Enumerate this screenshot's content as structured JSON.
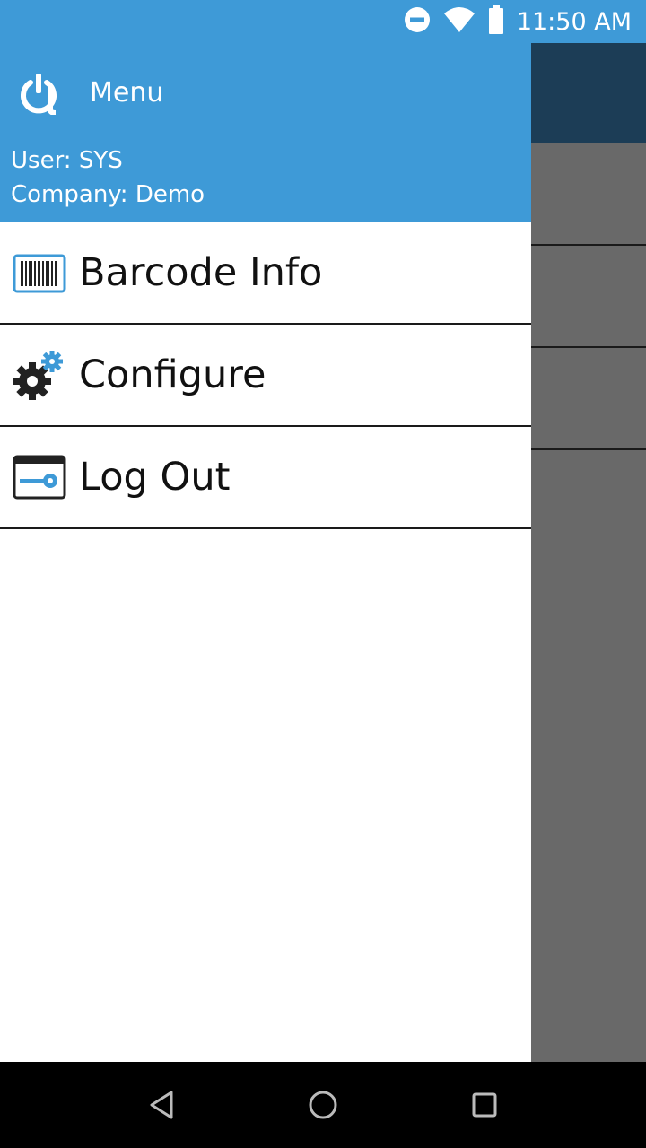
{
  "status_bar": {
    "time": "11:50 AM",
    "icons": [
      "do-not-disturb-icon",
      "wifi-icon",
      "battery-icon"
    ]
  },
  "drawer": {
    "header": {
      "title": "Menu",
      "user": "User: SYS",
      "company": "Company: Demo",
      "logo_icon": "power-logo-icon"
    },
    "items": [
      {
        "label": "Barcode Info",
        "icon": "barcode-icon"
      },
      {
        "label": "Configure",
        "icon": "gears-icon"
      },
      {
        "label": "Log Out",
        "icon": "key-card-icon"
      }
    ]
  },
  "nav_bar": {
    "buttons": [
      "back-icon",
      "home-icon",
      "recents-icon"
    ]
  },
  "colors": {
    "header_blue": "#3e9ad7",
    "toolbar_dark": "#1c3d56",
    "scrim_gray": "#696969",
    "icon_blue": "#3e9ad7"
  }
}
